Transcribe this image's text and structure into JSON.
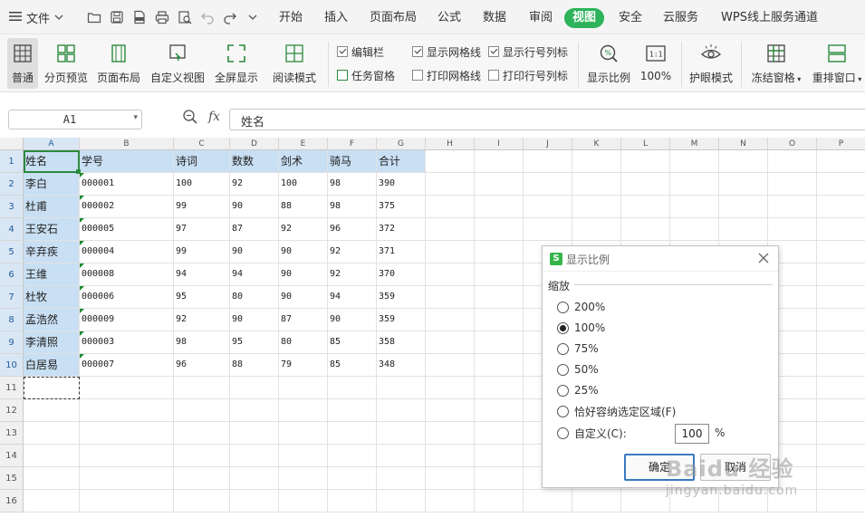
{
  "menubar": {
    "file_label": "文件",
    "tabs": [
      {
        "label": "开始"
      },
      {
        "label": "插入"
      },
      {
        "label": "页面布局"
      },
      {
        "label": "公式"
      },
      {
        "label": "数据"
      },
      {
        "label": "审阅"
      },
      {
        "label": "视图",
        "active": true
      },
      {
        "label": "安全"
      },
      {
        "label": "云服务"
      },
      {
        "label": "WPS线上服务通道"
      }
    ],
    "accent_color": "#2db35a"
  },
  "ribbon": {
    "buttons": [
      {
        "label": "普通",
        "icon": "normal-view-icon",
        "active": true
      },
      {
        "label": "分页预览",
        "icon": "page-break-preview-icon"
      },
      {
        "label": "页面布局",
        "icon": "page-layout-icon"
      },
      {
        "label": "自定义视图",
        "icon": "custom-view-icon"
      },
      {
        "label": "全屏显示",
        "icon": "fullscreen-icon"
      },
      {
        "label": "阅读模式",
        "icon": "reading-mode-icon"
      },
      {
        "label": "显示比例",
        "icon": "zoom-icon"
      },
      {
        "label": "100%",
        "icon": "zoom-100-icon"
      },
      {
        "label": "护眼模式",
        "icon": "eye-protection-icon"
      },
      {
        "label": "冻结窗格",
        "icon": "freeze-panes-icon"
      },
      {
        "label": "重排窗口",
        "icon": "arrange-windows-icon"
      }
    ],
    "checks": [
      {
        "label": "编辑栏",
        "checked": true
      },
      {
        "label": "任务窗格",
        "checked": false
      },
      {
        "label": "显示网格线",
        "checked": true
      },
      {
        "label": "打印网格线",
        "checked": false
      },
      {
        "label": "显示行号列标",
        "checked": true
      },
      {
        "label": "打印行号列标",
        "checked": false
      }
    ]
  },
  "formula_bar": {
    "name_box": "A1",
    "fx": "fx",
    "value": "姓名"
  },
  "sheet": {
    "col_letters": [
      "A",
      "B",
      "C",
      "D",
      "E",
      "F",
      "G",
      "H",
      "I",
      "J",
      "K",
      "L",
      "M",
      "N",
      "O",
      "P"
    ],
    "row_numbers": [
      "1",
      "2",
      "3",
      "4",
      "5",
      "6",
      "7",
      "8",
      "9",
      "10",
      "11",
      "12",
      "13",
      "14",
      "15",
      "16"
    ],
    "headers": [
      "姓名",
      "学号",
      "诗词",
      "数数",
      "剑术",
      "骑马",
      "合计"
    ],
    "rows": [
      [
        "李白",
        "000001",
        "100",
        "92",
        "100",
        "98",
        "390"
      ],
      [
        "杜甫",
        "000002",
        "99",
        "90",
        "88",
        "98",
        "375"
      ],
      [
        "王安石",
        "000005",
        "97",
        "87",
        "92",
        "96",
        "372"
      ],
      [
        "辛弃疾",
        "000004",
        "99",
        "90",
        "90",
        "92",
        "371"
      ],
      [
        "王维",
        "000008",
        "94",
        "94",
        "90",
        "92",
        "370"
      ],
      [
        "杜牧",
        "000006",
        "95",
        "80",
        "90",
        "94",
        "359"
      ],
      [
        "孟浩然",
        "000009",
        "92",
        "90",
        "87",
        "90",
        "359"
      ],
      [
        "李清照",
        "000003",
        "98",
        "95",
        "80",
        "85",
        "358"
      ],
      [
        "白居易",
        "000007",
        "96",
        "88",
        "79",
        "85",
        "348"
      ]
    ],
    "selection_color": "#c9dff3"
  },
  "dialog": {
    "title": "显示比例",
    "group_label": "缩放",
    "options": [
      {
        "label": "200%",
        "selected": false
      },
      {
        "label": "100%",
        "selected": true
      },
      {
        "label": "75%",
        "selected": false
      },
      {
        "label": "50%",
        "selected": false
      },
      {
        "label": "25%",
        "selected": false
      },
      {
        "label": "恰好容纳选定区域(F)",
        "selected": false
      },
      {
        "label": "自定义(C):",
        "selected": false
      }
    ],
    "custom_value": "100",
    "percent_sign": "%",
    "ok_label": "确定",
    "cancel_label": "取消"
  },
  "watermark": {
    "main": "Baidu 经验",
    "sub": "jingyan.baidu.com"
  }
}
